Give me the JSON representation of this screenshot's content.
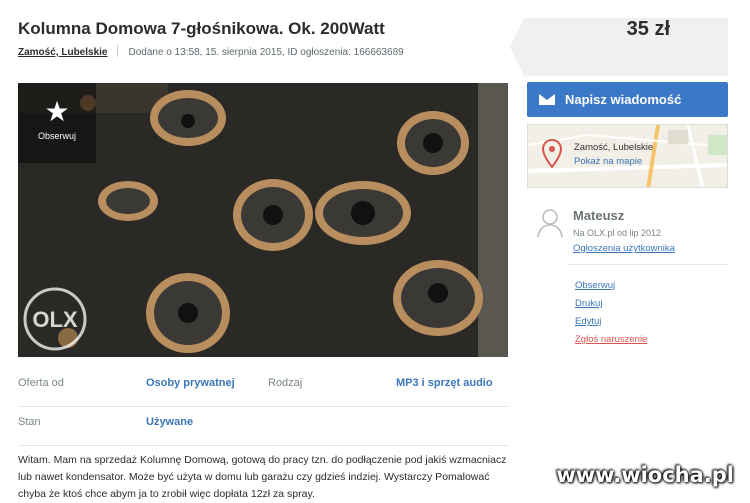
{
  "listing": {
    "title": "Kolumna Domowa 7-głośnikowa. Ok. 200Watt",
    "location": "Zamość, Lubelskie",
    "meta": "Dodane o 13:58, 15. sierpnia 2015, ID ogłoszenia: 166663689",
    "price": "35 zł"
  },
  "photo": {
    "watch_label": "Obserwuj",
    "watermark_logo": "OLX"
  },
  "details": {
    "offer_label": "Oferta od",
    "offer_value": "Osoby prywatnej",
    "type_label": "Rodzaj",
    "type_value": "MP3 i sprzęt audio",
    "state_label": "Stan",
    "state_value": "Używane"
  },
  "description": "Witam. Mam na sprzedaż Kolumnę Domową, gotową do pracy tzn. do podłączenie pod jakiś wzmacniacz lub nawet kondensator. Może być użyta w domu lub garażu czy gdzieś indziej. Wystarczy Pomalować chyba że ktoś chce abym ja to zrobił więc dopłata 12zł za spray.",
  "sidebar": {
    "message_button": "Napisz wiadomość",
    "map_location": "Zamość, Lubelskie",
    "map_link": "Pokaż na mapie",
    "user_name": "Mateusz",
    "user_since": "Na OLX.pl od lip 2012",
    "user_ads": "Ogłoszenia użytkownika",
    "actions": [
      "Obserwuj",
      "Drukuj",
      "Edytuj",
      "Zgłoś naruszenie"
    ]
  },
  "watermark": "www.wiocha.pl",
  "colors": {
    "link": "#3b76b8",
    "button": "#3b79c8",
    "report": "#d9534f",
    "price_bg": "#f0f0f0"
  }
}
